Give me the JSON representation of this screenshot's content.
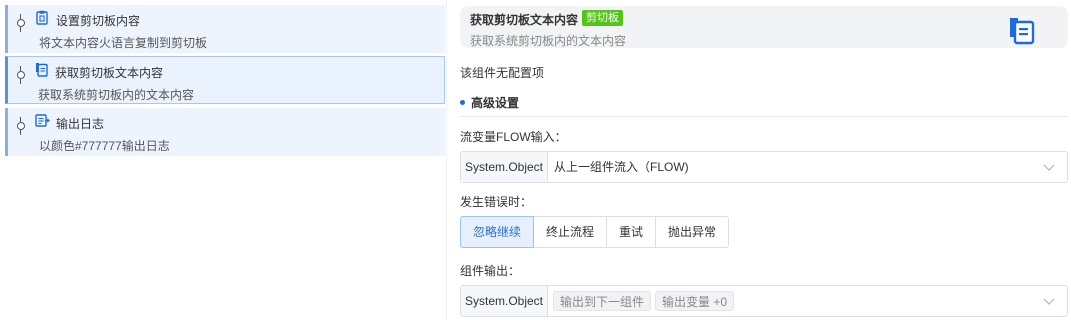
{
  "flow": {
    "nodes": [
      {
        "title": "设置剪切板内容",
        "desc": "将文本内容火语言复制到剪切板",
        "icon": "clipboard-set-icon"
      },
      {
        "title": "获取剪切板文本内容",
        "desc": "获取系统剪切板内的文本内容",
        "icon": "clipboard-get-icon"
      },
      {
        "title": "输出日志",
        "desc": "以颜色#777777输出日志",
        "icon": "log-output-icon"
      }
    ]
  },
  "component": {
    "title": "获取剪切板文本内容",
    "badge": "剪切板",
    "subtitle": "获取系统剪切板内的文本内容",
    "icon": "clipboard-icon",
    "accent": "#1d6ae5",
    "badge_color": "#52c41a"
  },
  "config": {
    "no_config": "该组件无配置项",
    "advanced_title": "高级设置",
    "flow_input_label": "流变量FLOW输入：",
    "flow_input": {
      "type": "System.Object",
      "value": "从上一组件流入（FLOW)"
    },
    "error_label": "发生错误时：",
    "error_options": [
      "忽略继续",
      "终止流程",
      "重试",
      "抛出异常"
    ],
    "error_selected": "忽略继续",
    "output_label": "组件输出：",
    "output": {
      "type": "System.Object",
      "tags": [
        "输出到下一组件",
        "输出变量 +0"
      ]
    }
  }
}
